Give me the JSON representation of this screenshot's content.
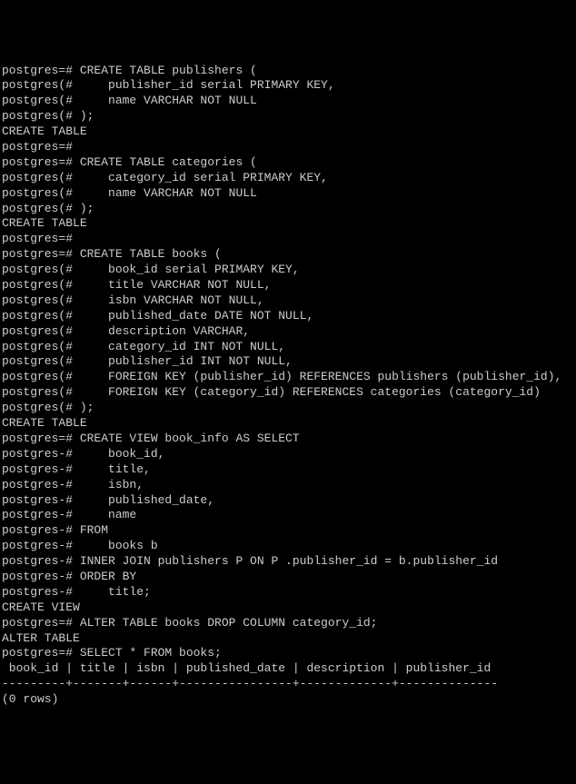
{
  "lines": [
    "postgres=# CREATE TABLE publishers (",
    "postgres(#     publisher_id serial PRIMARY KEY,",
    "postgres(#     name VARCHAR NOT NULL",
    "postgres(# );",
    "CREATE TABLE",
    "postgres=#",
    "postgres=# CREATE TABLE categories (",
    "postgres(#     category_id serial PRIMARY KEY,",
    "postgres(#     name VARCHAR NOT NULL",
    "postgres(# );",
    "CREATE TABLE",
    "postgres=#",
    "postgres=# CREATE TABLE books (",
    "postgres(#     book_id serial PRIMARY KEY,",
    "postgres(#     title VARCHAR NOT NULL,",
    "postgres(#     isbn VARCHAR NOT NULL,",
    "postgres(#     published_date DATE NOT NULL,",
    "postgres(#     description VARCHAR,",
    "postgres(#     category_id INT NOT NULL,",
    "postgres(#     publisher_id INT NOT NULL,",
    "postgres(#     FOREIGN KEY (publisher_id) REFERENCES publishers (publisher_id),",
    "postgres(#     FOREIGN KEY (category_id) REFERENCES categories (category_id)",
    "postgres(# );",
    "CREATE TABLE",
    "postgres=# CREATE VIEW book_info AS SELECT",
    "postgres-#     book_id,",
    "postgres-#     title,",
    "postgres-#     isbn,",
    "postgres-#     published_date,",
    "postgres-#     name",
    "postgres-# FROM",
    "postgres-#     books b",
    "postgres-# INNER JOIN publishers P ON P .publisher_id = b.publisher_id",
    "postgres-# ORDER BY",
    "postgres-#     title;",
    "CREATE VIEW",
    "postgres=# ALTER TABLE books DROP COLUMN category_id;",
    "ALTER TABLE",
    "postgres=# SELECT * FROM books;",
    " book_id | title | isbn | published_date | description | publisher_id",
    "---------+-------+------+----------------+-------------+--------------",
    "(0 rows)"
  ]
}
